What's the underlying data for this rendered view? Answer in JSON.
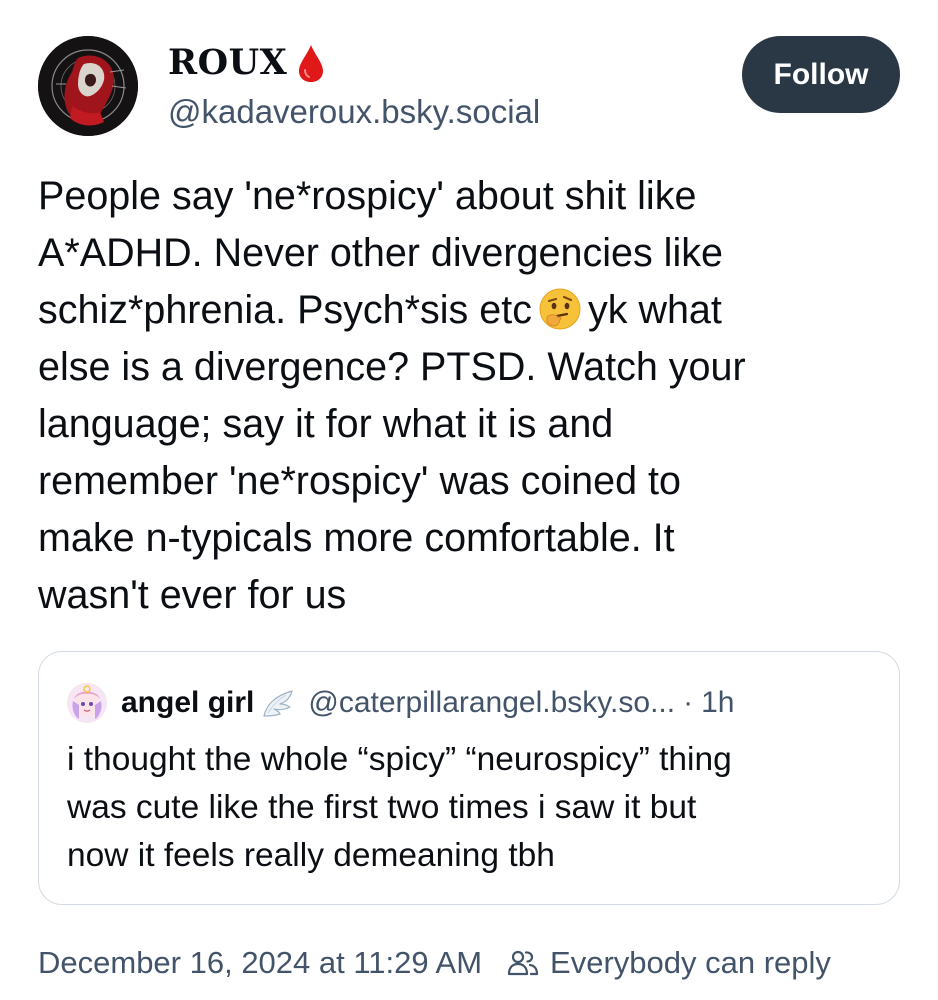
{
  "author": {
    "display_name": "ROUX",
    "handle": "@kadaveroux.bsky.social",
    "name_icon": "blood-drop-icon",
    "name_icon_color": "#e01818"
  },
  "follow_button": {
    "label": "Follow",
    "color": "#2a3845"
  },
  "post": {
    "lines": [
      "People say 'ne*rospicy' about shit like",
      "A*ADHD. Never other divergencies like",
      "schiz*phrenia. Psych*sis etc",
      "yk what",
      "else is a divergence? PTSD. Watch your",
      "language; say it for what it is and",
      "remember 'ne*rospicy' was coined to",
      "make n-typicals more comfortable. It",
      "wasn't ever for us"
    ],
    "emoji": "thinking-face-emoji"
  },
  "quote": {
    "name": "angel girl",
    "name_icon": "angel-wing-icon",
    "handle": "@caterpillarangel.bsky.so...",
    "separator": "·",
    "time": "1h",
    "lines": [
      "i thought the whole “spicy” “neurospicy” thing",
      "was cute like the first two times i saw it but",
      "now it feels really demeaning tbh"
    ]
  },
  "footer": {
    "timestamp": "December 16, 2024 at 11:29 AM",
    "reply_setting": "Everybody can reply",
    "reply_icon": "people-icon"
  },
  "colors": {
    "text": "#0b0f14",
    "muted": "#43546a",
    "border": "#d4dbe2"
  }
}
